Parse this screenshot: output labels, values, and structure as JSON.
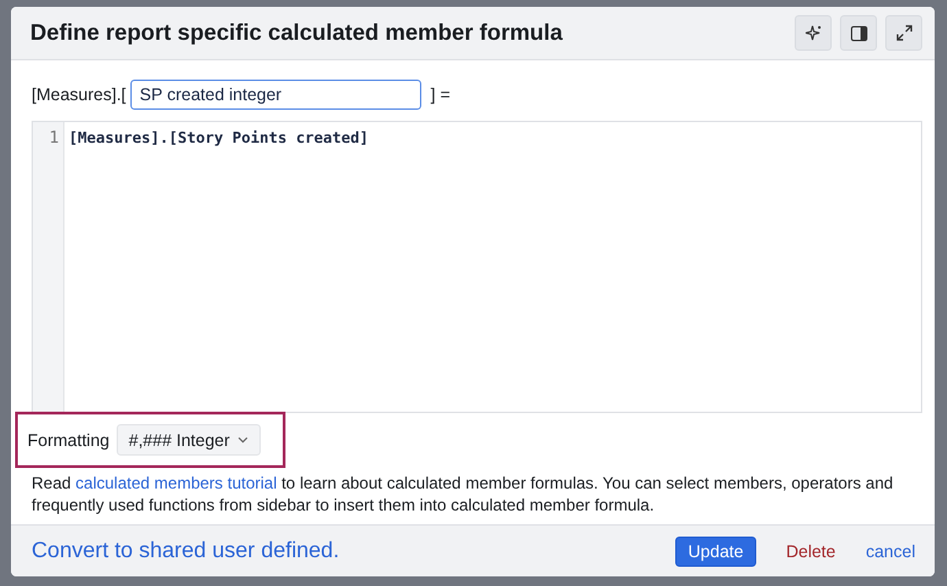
{
  "dialog": {
    "title": "Define report specific calculated member formula"
  },
  "header_buttons": [
    {
      "kind": "sparkle"
    },
    {
      "kind": "sidebar"
    },
    {
      "kind": "expand"
    }
  ],
  "name_prefix": "[Measures].[",
  "name_value": "SP created integer",
  "name_suffix": "] =",
  "editor": {
    "lines": [
      {
        "number": "1",
        "code": "[Measures].[Story Points created]"
      }
    ]
  },
  "formatting": {
    "label": "Formatting",
    "value": "#,### Integer",
    "highlighted": true
  },
  "help": {
    "before": "Read ",
    "link": "calculated members tutorial",
    "after": " to learn about calculated member formulas. You can select members, operators and frequently used functions from sidebar to insert them into calculated member formula."
  },
  "footer": {
    "convert_link": "Convert to shared user defined.",
    "buttons": [
      {
        "label": "Update",
        "kind": "primary"
      },
      {
        "label": "Delete",
        "kind": "danger"
      },
      {
        "label": "cancel",
        "kind": "link"
      }
    ]
  }
}
